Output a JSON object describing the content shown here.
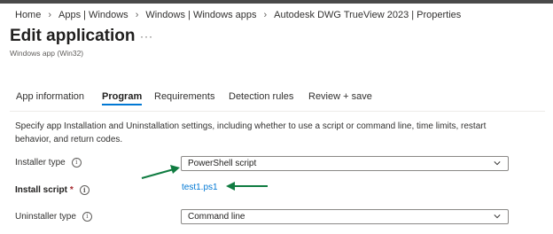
{
  "breadcrumb": [
    "Home",
    "Apps | Windows",
    "Windows | Windows apps",
    "Autodesk DWG TrueView 2023 | Properties"
  ],
  "page": {
    "title": "Edit application",
    "subtitle": "Windows app (Win32)",
    "more_icon": "ellipsis-icon"
  },
  "tabs": [
    {
      "label": "App information",
      "active": false
    },
    {
      "label": "Program",
      "active": true
    },
    {
      "label": "Requirements",
      "active": false
    },
    {
      "label": "Detection rules",
      "active": false
    },
    {
      "label": "Review + save",
      "active": false
    }
  ],
  "description": "Specify app Installation and Uninstallation settings, including whether to use a script or command line, time limits, restart behavior, and return codes.",
  "form": {
    "installer_type": {
      "label": "Installer type",
      "value": "PowerShell script"
    },
    "install_script": {
      "label": "Install script",
      "required_mark": "*",
      "file": "test1.ps1"
    },
    "uninstaller_type": {
      "label": "Uninstaller type",
      "value": "Command line"
    }
  },
  "colors": {
    "accent": "#0078d4",
    "arrow": "#107c41",
    "required": "#a4262c"
  },
  "icons": {
    "info": "info-icon",
    "chevron": "chevron-down-icon",
    "arrow": "green-arrow-annotation"
  }
}
